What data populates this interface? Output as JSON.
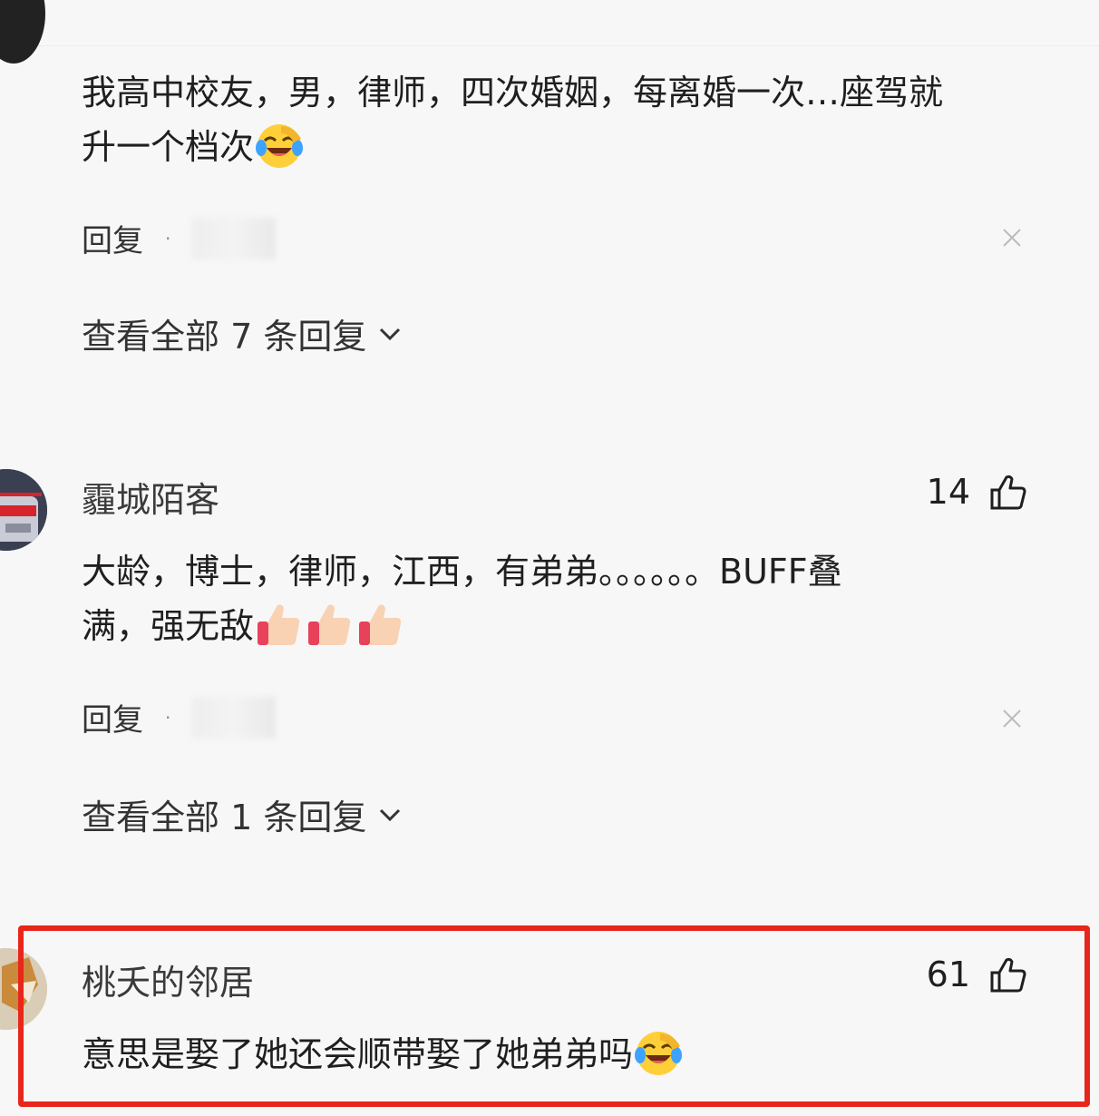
{
  "comments": [
    {
      "text_line1": "我高中校友，男，律师，四次婚姻，每离婚一次…座驾就",
      "text_line2": "升一个档次",
      "emoji": "laughing-crying-emoji",
      "reply_label": "回复",
      "separator": "·",
      "view_all_label": "查看全部 7 条回复"
    },
    {
      "username": "霾城陌客",
      "likes": "14",
      "text_line1": "大龄，博士，律师，江西，有弟弟。。。。。。BUFF叠",
      "text_line2": "满，强无敌",
      "emoji": "thumbs-up-emoji",
      "reply_label": "回复",
      "separator": "·",
      "view_all_label": "查看全部 1 条回复"
    },
    {
      "username": "桃夭的邻居",
      "likes": "61",
      "text_line1": "意思是娶了她还会顺带娶了她弟弟吗",
      "emoji": "laughing-crying-emoji"
    }
  ],
  "colors": {
    "background": "#f7f7f7",
    "text": "#1f1f1f",
    "highlight": "#e8261b"
  }
}
